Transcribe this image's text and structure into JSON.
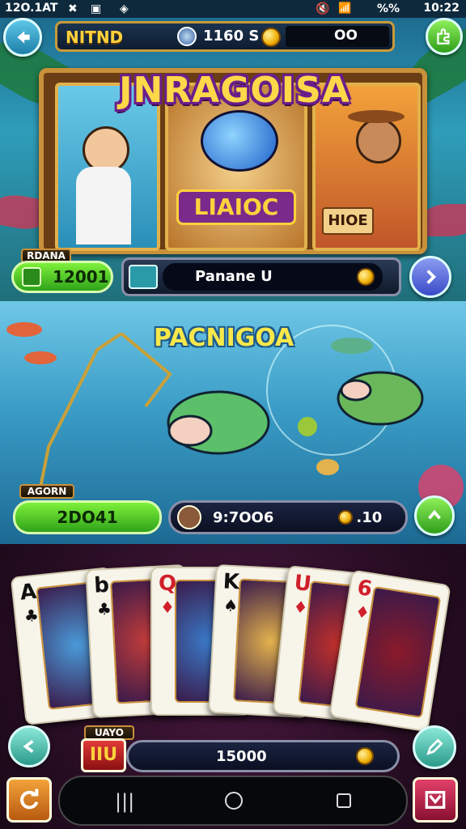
{
  "status_bar": {
    "time_left": "12O.1AT",
    "battery": "%%",
    "time_right": "10:22"
  },
  "top_bar": {
    "label": "NITND",
    "balance": "1160 S",
    "coins": "OO"
  },
  "banner": {
    "title": "JNRAGOISA",
    "center_badge": "LIAIOC",
    "right_label": "HIOE"
  },
  "row1": {
    "tag": "RDANA",
    "value": "12001",
    "text": "Panane U"
  },
  "middle": {
    "title": "PACNIGOA"
  },
  "row2": {
    "tag": "AGORN",
    "value": "2DO41",
    "text": "9:7OO6",
    "coin_value": ".10"
  },
  "cards": [
    {
      "rank": "A",
      "suit": "♣",
      "color": "#111"
    },
    {
      "rank": "b",
      "suit": "♣",
      "color": "#111"
    },
    {
      "rank": "Q",
      "suit": "♦",
      "color": "#d01f2a"
    },
    {
      "rank": "K",
      "suit": "♠",
      "color": "#111"
    },
    {
      "rank": "U",
      "suit": "♦",
      "color": "#d01f2a"
    },
    {
      "rank": "6",
      "suit": "♦",
      "color": "#d01f2a"
    }
  ],
  "bottom_bar": {
    "tag": "UAYO",
    "value": "IIU",
    "amount": "15000"
  },
  "colors": {
    "gold": "#ffd23c",
    "green": "#4ccf2a",
    "frame": "#c9903a"
  }
}
